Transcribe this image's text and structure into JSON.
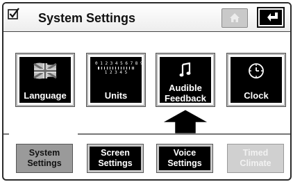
{
  "header": {
    "title": "System Settings",
    "check_icon": "checkbox-checked-icon",
    "home_icon": "home-icon",
    "back_icon": "back-arrow-icon"
  },
  "tiles": [
    {
      "label": "Language",
      "icon": "flag-icon"
    },
    {
      "label": "Units",
      "icon": "ruler-icon",
      "icon_text_top": "0 1 2 3 4 5 6 7 8 9 10",
      "icon_text_bottom": "1 2 3 4 5"
    },
    {
      "label_line1": "Audible",
      "label_line2": "Feedback",
      "icon": "music-note-icon"
    },
    {
      "label": "Clock",
      "icon": "clock-icon"
    }
  ],
  "tabs": [
    {
      "line1": "System",
      "line2": "Settings",
      "state": "active"
    },
    {
      "line1": "Screen",
      "line2": "Settings",
      "state": "normal"
    },
    {
      "line1": "Voice",
      "line2": "Settings",
      "state": "normal"
    },
    {
      "line1": "Timed",
      "line2": "Climate",
      "state": "disabled"
    }
  ],
  "colors": {
    "tile_background": "#000000",
    "active_tab": "#9a9a9a",
    "disabled_tab": "#d0d0d0"
  }
}
